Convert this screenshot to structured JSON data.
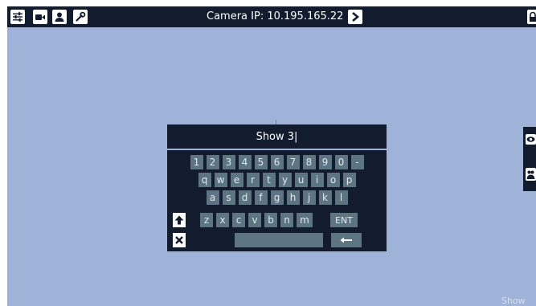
{
  "topbar": {
    "title": "Camera IP: 10.195.165.22",
    "icons": [
      "sliders-icon",
      "camera-icon",
      "user-icon",
      "wrench-icon",
      "chevron-right-icon",
      "lock-icon"
    ]
  },
  "keyboard": {
    "display_text": "Show 3|",
    "row1": [
      "1",
      "2",
      "3",
      "4",
      "5",
      "6",
      "7",
      "8",
      "9",
      "0",
      "-"
    ],
    "row2": [
      "q",
      "w",
      "e",
      "r",
      "t",
      "y",
      "u",
      "i",
      "o",
      "p"
    ],
    "row3": [
      "a",
      "s",
      "d",
      "f",
      "g",
      "h",
      "j",
      "k",
      "l"
    ],
    "row4": [
      "z",
      "x",
      "c",
      "v",
      "b",
      "n",
      "m"
    ],
    "enter_label": "ENT"
  },
  "side_panel": {
    "icons": [
      "eye-icon",
      "users-icon"
    ]
  },
  "watermark": "Show",
  "colors": {
    "background": "#9fb3d9",
    "bar": "#121c2e",
    "key": "#5d7582",
    "accent_line": "#e05555"
  }
}
